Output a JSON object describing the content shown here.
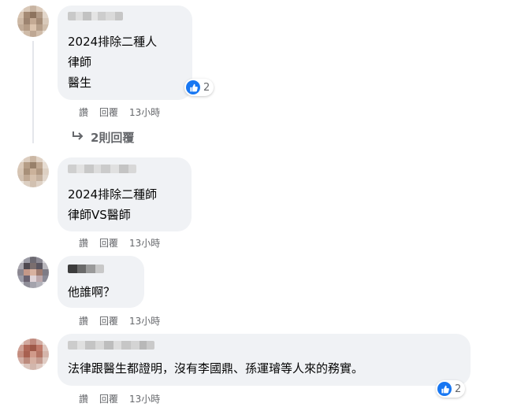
{
  "comments": [
    {
      "lines": [
        "2024排除二種人",
        "律師",
        "醫生"
      ],
      "actions": {
        "like": "讚",
        "reply": "回覆",
        "time": "13小時"
      },
      "reactions": {
        "icon": "like-icon",
        "count": "2"
      },
      "view_replies": "2則回覆"
    },
    {
      "lines": [
        "2024排除二種師",
        "律師VS醫師"
      ],
      "actions": {
        "like": "讚",
        "reply": "回覆",
        "time": "13小時"
      }
    },
    {
      "lines": [
        "他誰啊？"
      ],
      "actions": {
        "like": "讚",
        "reply": "回覆",
        "time": "13小時"
      }
    },
    {
      "lines": [
        "法律跟醫生都證明，沒有李國鼎、孫運璿等人來的務實。"
      ],
      "actions": {
        "like": "讚",
        "reply": "回覆",
        "time": "13小時"
      },
      "reactions": {
        "icon": "like-icon",
        "count": "2"
      }
    }
  ],
  "colors": {
    "bubble": "#f0f2f5",
    "meta": "#65676b",
    "like_blue": "#1877f2"
  }
}
